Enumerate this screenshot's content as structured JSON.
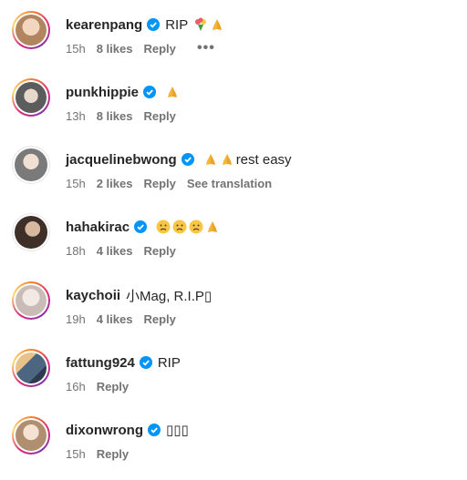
{
  "comments": [
    {
      "username": "kearenpang",
      "text": "RIP",
      "emojis": [
        "bouquet",
        "folded-hands"
      ],
      "time": "15h",
      "likes": "8 likes",
      "reply": "Reply",
      "ring": "story",
      "avatar_color": "#c9a07a"
    },
    {
      "username": "punkhippie",
      "text": "",
      "emojis": [
        "folded-hands"
      ],
      "time": "13h",
      "likes": "8 likes",
      "reply": "Reply",
      "ring": "story",
      "avatar_color": "#6e6e6e"
    },
    {
      "username": "jacquelinebwong",
      "text": "rest easy",
      "emojis": [
        "folded-hands",
        "folded-hands"
      ],
      "time": "15h",
      "likes": "2 likes",
      "reply": "Reply",
      "see_translation": "See translation",
      "ring": "none",
      "avatar_color": "#8a8a8a"
    },
    {
      "username": "hahakirac",
      "text": "",
      "emojis": [
        "sad-face",
        "sad-face",
        "sad-face",
        "folded-hands"
      ],
      "time": "18h",
      "likes": "4 likes",
      "reply": "Reply",
      "ring": "none",
      "avatar_color": "#4a3a33"
    },
    {
      "username": "kaychoii",
      "text": "小Mag, R.I.P▯",
      "emojis": [],
      "time": "19h",
      "likes": "4 likes",
      "reply": "Reply",
      "ring": "story",
      "avatar_color": "#d8d0cc"
    },
    {
      "username": "fattung924",
      "text": "RIP",
      "emojis": [],
      "time": "16h",
      "likes": "",
      "reply": "Reply",
      "ring": "story",
      "avatar_color": "#5b6f8a"
    },
    {
      "username": "dixonwrong",
      "text": "▯▯▯",
      "emojis": [],
      "time": "15h",
      "likes": "",
      "reply": "Reply",
      "ring": "story",
      "avatar_color": "#b79a7c"
    }
  ],
  "more_options": "•••",
  "colors": {
    "verified": "#0095f6",
    "muted": "#737373",
    "text": "#262626"
  }
}
